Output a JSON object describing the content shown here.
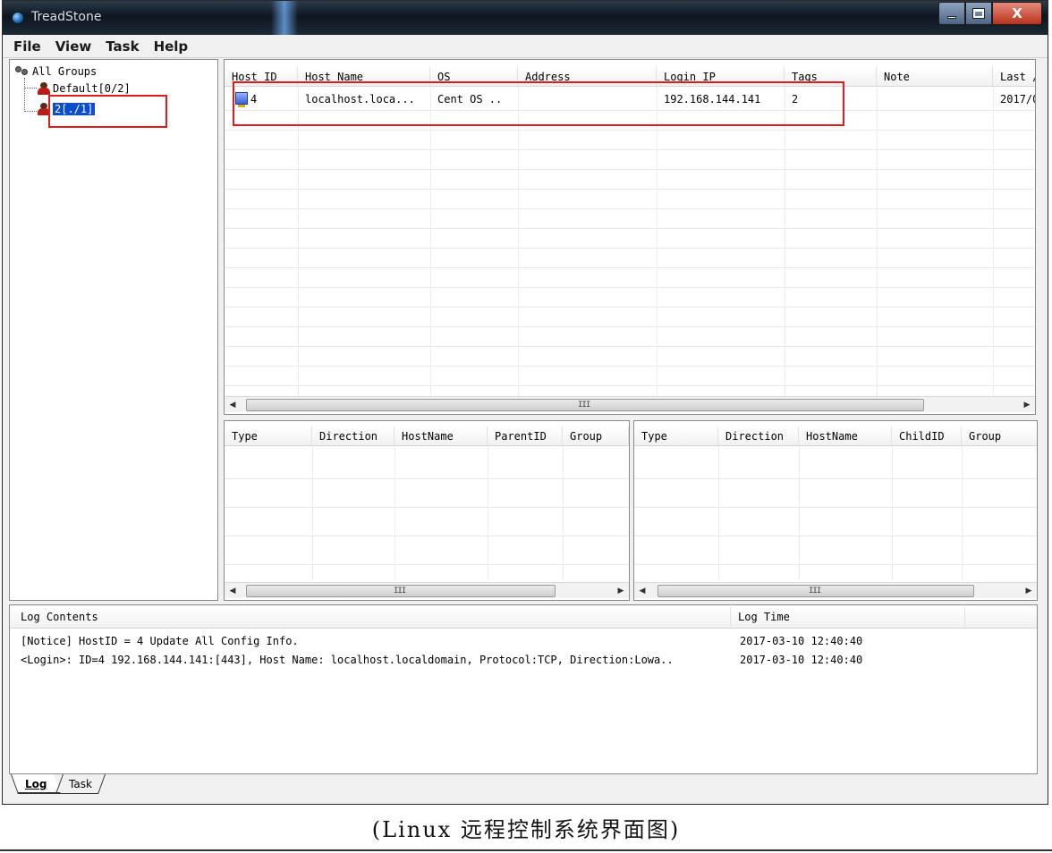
{
  "window": {
    "title": "TreadStone",
    "close_label": "X"
  },
  "menu": [
    "File",
    "View",
    "Task",
    "Help"
  ],
  "tree": {
    "root": "All Groups",
    "groups": [
      {
        "label": "Default[0/2]",
        "selected": false
      },
      {
        "label": "2[./1]",
        "selected": true
      }
    ]
  },
  "hosts": {
    "columns": [
      "Host ID",
      "Host Name",
      "OS",
      "Address",
      "Login IP",
      "Tags",
      "Note",
      "Last /"
    ],
    "rows": [
      {
        "id": "4",
        "host_name": "localhost.loca...",
        "os": "Cent OS ..",
        "address": "",
        "login_ip": "192.168.144.141",
        "tags": "2",
        "note": "",
        "last": "2017/0"
      }
    ],
    "scroll_grip": "III"
  },
  "parent_links": {
    "columns": [
      "Type",
      "Direction",
      "HostName",
      "ParentID",
      "Group"
    ],
    "scroll_grip": "III"
  },
  "child_links": {
    "columns": [
      "Type",
      "Direction",
      "HostName",
      "ChildID",
      "Group"
    ],
    "scroll_grip": "III"
  },
  "log": {
    "columns": [
      "Log Contents",
      "Log Time"
    ],
    "entries": [
      {
        "text": "[Notice] HostID = 4 Update All Config Info.",
        "time": "2017-03-10 12:40:40"
      },
      {
        "text": "<Login>: ID=4 192.168.144.141:[443], Host Name: localhost.localdomain, Protocol:TCP, Direction:Lowa..",
        "time": "2017-03-10 12:40:40"
      }
    ]
  },
  "tabs": [
    "Log",
    "Task"
  ],
  "caption": "(Linux 远程控制系统界面图)",
  "colors": {
    "highlight_red": "#e21a1a",
    "selection_blue": "#0a4dd0"
  }
}
